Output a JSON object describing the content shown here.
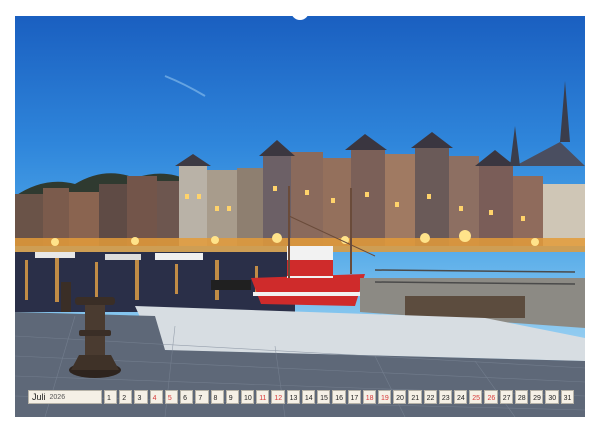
{
  "calendar": {
    "month_label": "Juli",
    "year_label": "2026",
    "days": [
      "1",
      "2",
      "3",
      "4",
      "5",
      "6",
      "7",
      "8",
      "9",
      "10",
      "11",
      "12",
      "13",
      "14",
      "15",
      "16",
      "17",
      "18",
      "19",
      "20",
      "21",
      "22",
      "23",
      "24",
      "25",
      "26",
      "27",
      "28",
      "29",
      "30",
      "31"
    ],
    "weekend_days": [
      "4",
      "5",
      "11",
      "12",
      "18",
      "19",
      "25",
      "26"
    ]
  },
  "colors": {
    "sky_top": "#1a5fc0",
    "sky_bottom": "#bfe1f7",
    "lights": "#ffd36b",
    "boat_red": "#cf2b2b",
    "weekend_text": "#d63a3a",
    "strip_bg": "#f5f0e6"
  },
  "icons": {
    "bollard": "bollard-icon",
    "hanger": "hanger-notch-icon"
  }
}
